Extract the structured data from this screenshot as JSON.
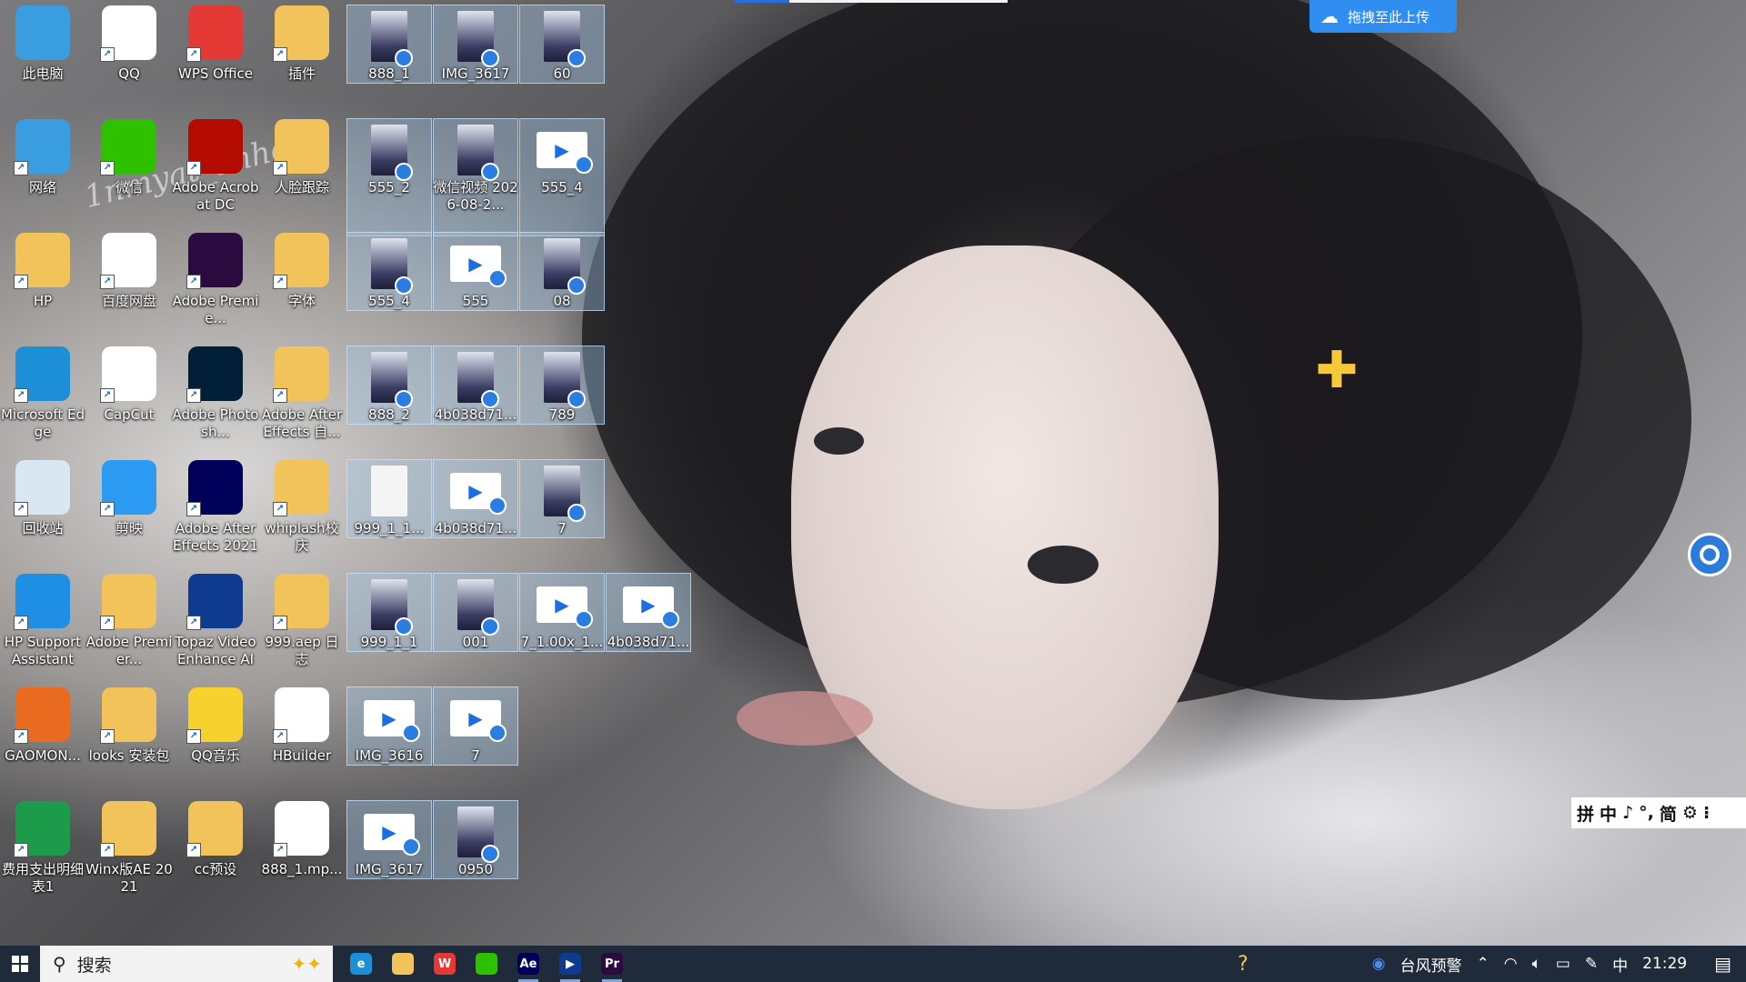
{
  "desktop": {
    "watermark": "1nmyat_anhe",
    "icons": [
      {
        "label": "此电脑",
        "icon": "computer-icon",
        "color": "#3a9de0"
      },
      {
        "label": "QQ",
        "icon": "qq-icon",
        "color": "#ffffff"
      },
      {
        "label": "WPS Office",
        "icon": "wps-icon",
        "color": "#e53935"
      },
      {
        "label": "插件",
        "icon": "folder-icon",
        "color": "#f2c35b"
      },
      {
        "label": "网络",
        "icon": "network-icon",
        "color": "#3a9de0"
      },
      {
        "label": "微信",
        "icon": "wechat-icon",
        "color": "#2dc100"
      },
      {
        "label": "Adobe Acrobat DC",
        "icon": "acrobat-icon",
        "color": "#b30b00"
      },
      {
        "label": "人脸跟踪",
        "icon": "folder-icon",
        "color": "#f2c35b"
      },
      {
        "label": "HP",
        "icon": "user-folder-icon",
        "color": "#f2c35b"
      },
      {
        "label": "百度网盘",
        "icon": "baidu-netdisk-icon",
        "color": "#ffffff"
      },
      {
        "label": "Adobe Premie...",
        "icon": "premiere-icon",
        "color": "#2a0a3f"
      },
      {
        "label": "字体",
        "icon": "folder-icon",
        "color": "#f2c35b"
      },
      {
        "label": "Microsoft Edge",
        "icon": "edge-icon",
        "color": "#1c8fd6"
      },
      {
        "label": "CapCut",
        "icon": "capcut-icon",
        "color": "#ffffff"
      },
      {
        "label": "Adobe Photosh...",
        "icon": "photoshop-icon",
        "color": "#001e36"
      },
      {
        "label": "Adobe After Effects 自...",
        "icon": "folder-icon",
        "color": "#f2c35b"
      },
      {
        "label": "回收站",
        "icon": "recycle-bin-icon",
        "color": "#d9e7f2"
      },
      {
        "label": "剪映",
        "icon": "jianying-icon",
        "color": "#2b9af3"
      },
      {
        "label": "Adobe After Effects 2021",
        "icon": "after-effects-icon",
        "color": "#00005b"
      },
      {
        "label": "whiplash校庆",
        "icon": "folder-icon",
        "color": "#f2c35b"
      },
      {
        "label": "HP Support Assistant",
        "icon": "help-icon",
        "color": "#1f8fe6"
      },
      {
        "label": "Adobe Premier...",
        "icon": "premiere-folder-icon",
        "color": "#f2c35b"
      },
      {
        "label": "Topaz Video Enhance AI",
        "icon": "topaz-icon",
        "color": "#0e3b8f"
      },
      {
        "label": "999.aep 日志",
        "icon": "folder-icon",
        "color": "#f2c35b"
      },
      {
        "label": "GAOMON...",
        "icon": "gaomon-icon",
        "color": "#e86b1f"
      },
      {
        "label": "looks 安装包",
        "icon": "folder-icon",
        "color": "#f2c35b"
      },
      {
        "label": "QQ音乐",
        "icon": "qq-music-icon",
        "color": "#f7d22e"
      },
      {
        "label": "HBuilder",
        "icon": "file-icon",
        "color": "#ffffff"
      },
      {
        "label": "费用支出明细表1",
        "icon": "wps-sheet-icon",
        "color": "#1c9b4a"
      },
      {
        "label": "Winx版AE 2021",
        "icon": "folder-icon",
        "color": "#f2c35b"
      },
      {
        "label": "cc预设",
        "icon": "folder-icon",
        "color": "#f2c35b"
      },
      {
        "label": "888_1.mp...",
        "icon": "file-icon",
        "color": "#ffffff"
      }
    ],
    "files": [
      {
        "label": "888_1",
        "kind": "photo"
      },
      {
        "label": "IMG_3617",
        "kind": "photo"
      },
      {
        "label": "60",
        "kind": "photo"
      },
      {
        "label": "555_2",
        "kind": "photo"
      },
      {
        "label": "微信视频 2026-08-2...",
        "kind": "photo"
      },
      {
        "label": "555_4",
        "kind": "video"
      },
      {
        "label": "555_4",
        "kind": "photo"
      },
      {
        "label": "555",
        "kind": "video"
      },
      {
        "label": "08",
        "kind": "photo"
      },
      {
        "label": "888_2",
        "kind": "photo"
      },
      {
        "label": "4b038d71...",
        "kind": "photo"
      },
      {
        "label": "789",
        "kind": "photo"
      },
      {
        "label": "999_1_1...",
        "kind": "blank"
      },
      {
        "label": "4b038d71...",
        "kind": "video"
      },
      {
        "label": "7",
        "kind": "photo"
      },
      {
        "label": "999_1_1",
        "kind": "photo"
      },
      {
        "label": "001",
        "kind": "photo"
      },
      {
        "label": "7_1.00x_1...",
        "kind": "video"
      },
      {
        "label": "4b038d71...",
        "kind": "video"
      },
      {
        "label": "IMG_3616",
        "kind": "video"
      },
      {
        "label": "7",
        "kind": "video"
      },
      {
        "label": "IMG_3617",
        "kind": "video"
      },
      {
        "label": "0950",
        "kind": "photo"
      }
    ]
  },
  "upload_button": {
    "label": "拖拽至此上传"
  },
  "ime_toolbar": {
    "items": [
      "拼",
      "中",
      "♪",
      "°,",
      "简",
      "⚙",
      "⁝"
    ]
  },
  "taskbar": {
    "search_placeholder": "搜索",
    "pinned": [
      {
        "name": "edge",
        "icon": "edge-icon",
        "color": "#1c8fd6",
        "text": "e"
      },
      {
        "name": "file-explorer",
        "icon": "folder-icon",
        "color": "#f2c35b",
        "text": ""
      },
      {
        "name": "wps",
        "icon": "wps-icon",
        "color": "#e53935",
        "text": "W"
      },
      {
        "name": "wechat",
        "icon": "wechat-icon",
        "color": "#2dc100",
        "text": ""
      },
      {
        "name": "after-effects",
        "icon": "after-effects-icon",
        "color": "#00005b",
        "text": "Ae"
      },
      {
        "name": "topaz",
        "icon": "topaz-icon",
        "color": "#0e3b8f",
        "text": "▶"
      },
      {
        "name": "premiere",
        "icon": "premiere-icon",
        "color": "#2a0a3f",
        "text": "Pr"
      }
    ],
    "tray": {
      "weather_alert": "台风预警",
      "ime_lang": "中",
      "clock": "21:29"
    }
  }
}
